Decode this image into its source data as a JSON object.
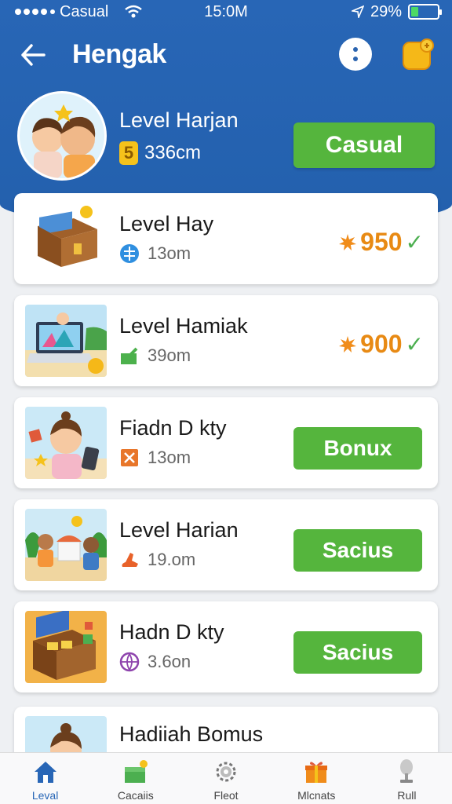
{
  "status_bar": {
    "carrier": "Casual",
    "time": "15:0M",
    "battery": "29%",
    "battery_level": 0.29
  },
  "app_bar": {
    "title": "Hengak",
    "back_icon": "arrow-left-icon",
    "more_icon": "more-vertical-icon",
    "badge_icon": "settings-badge-icon"
  },
  "profile": {
    "name": "Level Harjan",
    "coin_badge": "5",
    "distance": "336cm",
    "action_label": "Casual"
  },
  "levels": [
    {
      "title": "Level Hay",
      "sub": "13om",
      "sub_icon": "globe-icon",
      "reward": "950",
      "reward_check": "✓",
      "button": null
    },
    {
      "title": "Level Hamiak",
      "sub": "39om",
      "sub_icon": "flag-icon",
      "reward": "900",
      "reward_check": "✓",
      "button": null
    },
    {
      "title": "Fiadn D kty",
      "sub": "13om",
      "sub_icon": "close-box-icon",
      "reward": null,
      "button": "Bonux"
    },
    {
      "title": "Level Harian",
      "sub": "19.om",
      "sub_icon": "boot-icon",
      "reward": null,
      "button": "Sacius"
    },
    {
      "title": "Hadn D kty",
      "sub": "3.6on",
      "sub_icon": "globe-purple-icon",
      "reward": null,
      "button": "Sacius"
    },
    {
      "title": "Hadiiah Bomus",
      "sub": "",
      "sub_icon": "",
      "reward": null,
      "button": null
    }
  ],
  "bottom_nav": [
    {
      "label": "Leval",
      "icon": "home-icon",
      "active": true
    },
    {
      "label": "Cacaiis",
      "icon": "gift-box-icon",
      "active": false
    },
    {
      "label": "Fleot",
      "icon": "gear-icon",
      "active": false
    },
    {
      "label": "Mlcnats",
      "icon": "present-icon",
      "active": false
    },
    {
      "label": "Rull",
      "icon": "trophy-icon",
      "active": false
    }
  ],
  "colors": {
    "header_blue": "#2866b6",
    "accent_green": "#55b53d",
    "reward_orange": "#e88a14"
  }
}
